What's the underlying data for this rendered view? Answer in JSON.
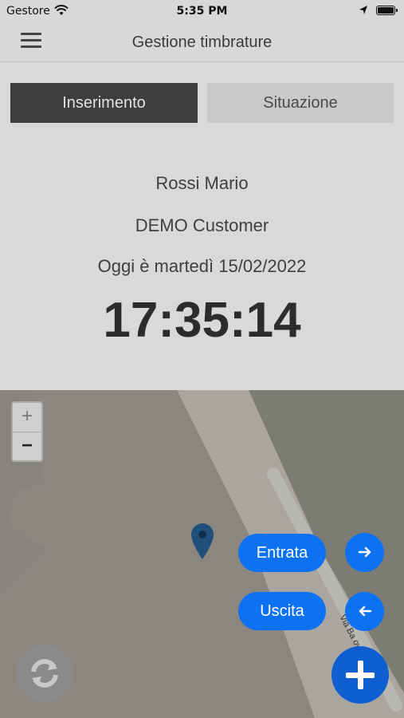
{
  "status_bar": {
    "carrier": "Gestore",
    "time": "5:35 PM"
  },
  "nav": {
    "title": "Gestione timbrature"
  },
  "tabs": [
    {
      "label": "Inserimento",
      "active": true
    },
    {
      "label": "Situazione",
      "active": false
    }
  ],
  "info": {
    "name": "Rossi Mario",
    "customer": "DEMO Customer",
    "date": "Oggi è martedì 15/02/2022",
    "clock": "17:35:14"
  },
  "map": {
    "zoom_in": "+",
    "zoom_out": "−",
    "street_label": "Via Ba   ovar"
  },
  "actions": {
    "entrata_label": "Entrata",
    "uscita_label": "Uscita",
    "entrata_icon": "arrow-right-icon",
    "uscita_icon": "arrow-left-icon"
  },
  "colors": {
    "accent": "#0d72f2",
    "overlay_gray": "#d9d9d9"
  }
}
